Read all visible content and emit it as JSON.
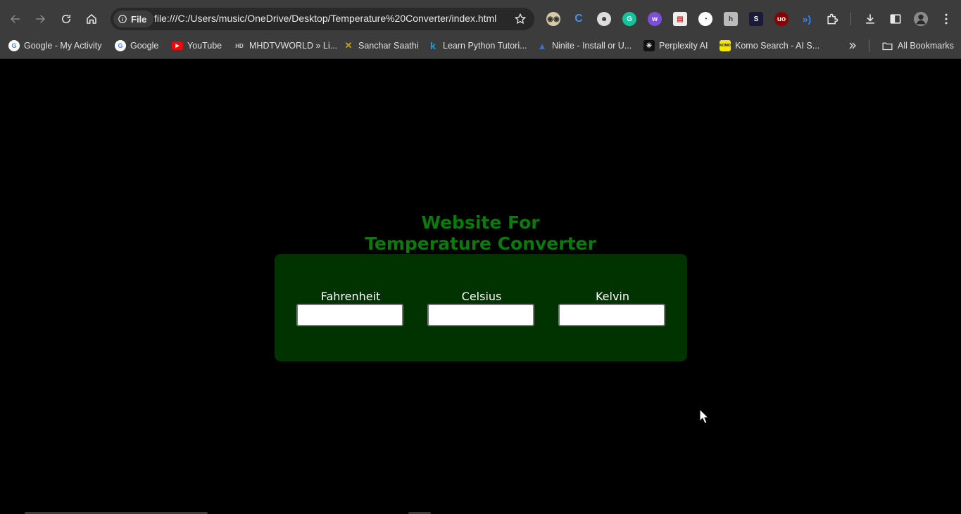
{
  "browser": {
    "site_chip": "File",
    "url": "file:///C:/Users/music/OneDrive/Desktop/Temperature%20Converter/index.html",
    "bookmarks": [
      {
        "label": "Google - My Activity",
        "icon": "google-icon"
      },
      {
        "label": "Google",
        "icon": "google-icon"
      },
      {
        "label": "YouTube",
        "icon": "youtube-icon"
      },
      {
        "label": "MHDTVWORLD » Li...",
        "icon": "mhdtv-icon"
      },
      {
        "label": "Sanchar Saathi",
        "icon": "sanchar-icon"
      },
      {
        "label": "Learn Python Tutori...",
        "icon": "k-icon"
      },
      {
        "label": "Ninite - Install or U...",
        "icon": "ninite-icon"
      },
      {
        "label": "Perplexity AI",
        "icon": "perplexity-icon"
      },
      {
        "label": "Komo Search - AI S...",
        "icon": "komo-icon"
      }
    ],
    "all_bookmarks": "All Bookmarks",
    "komo_badge": "KOMO"
  },
  "page": {
    "title_line1": "Website For",
    "title_line2": "Temperature Converter",
    "fields": [
      {
        "label": "Fahrenheit",
        "value": ""
      },
      {
        "label": "Celsius",
        "value": ""
      },
      {
        "label": "Kelvin",
        "value": ""
      }
    ]
  },
  "colors": {
    "title": "#0a7a0a",
    "panel": "#013300",
    "background": "#000000"
  }
}
